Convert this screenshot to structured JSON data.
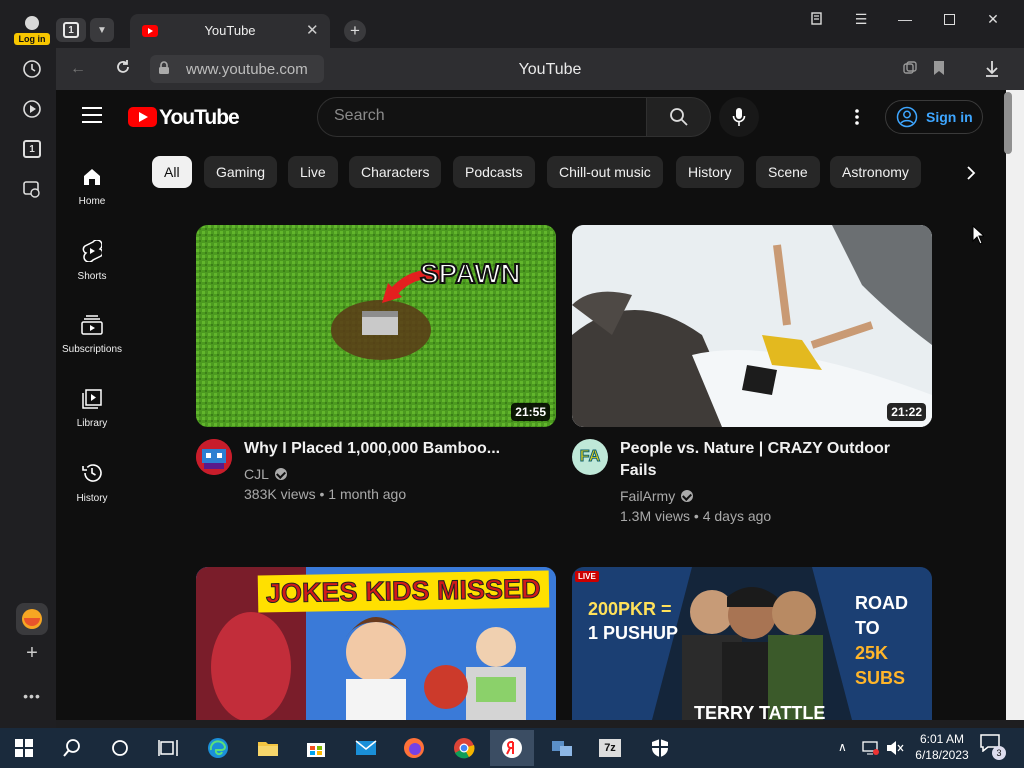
{
  "browser": {
    "login_label": "Log in",
    "tab_count": "1",
    "tab_title": "YouTube",
    "url": "www.youtube.com",
    "page_title": "YouTube",
    "sidebar_counter": "1"
  },
  "youtube": {
    "logo_text": "YouTube",
    "search_placeholder": "Search",
    "sign_in_label": "Sign in",
    "chips": [
      "All",
      "Gaming",
      "Live",
      "Characters",
      "Podcasts",
      "Chill-out music",
      "History",
      "Scene",
      "Astronomy"
    ],
    "sidebar": [
      {
        "label": "Home",
        "icon": "home-icon"
      },
      {
        "label": "Shorts",
        "icon": "shorts-icon"
      },
      {
        "label": "Subscriptions",
        "icon": "subscriptions-icon"
      },
      {
        "label": "Library",
        "icon": "library-icon"
      },
      {
        "label": "History",
        "icon": "history-icon"
      }
    ],
    "videos": [
      {
        "title": "Why I Placed 1,000,000 Bamboo...",
        "channel": "CJL",
        "meta": "383K views • 1 month ago",
        "duration": "21:55",
        "thumb_text": "SPAWN"
      },
      {
        "title_line1": "People vs. Nature | CRAZY Outdoor",
        "title_line2": "Fails",
        "channel": "FailArmy",
        "meta": "1.3M views • 4 days ago",
        "duration": "21:22",
        "avatar_text": "FA"
      },
      {
        "thumb_text": "JOKES KIDS MISSED"
      },
      {
        "live_badge": "LIVE",
        "thumb_left_line1": "200PKR =",
        "thumb_left_line2": "1 PUSHUP",
        "thumb_right_line1": "ROAD TO",
        "thumb_right_line2": "25K SUBS",
        "thumb_bottom": "TERRY TATTLE"
      }
    ]
  },
  "taskbar": {
    "time": "6:01 AM",
    "date": "6/18/2023",
    "notification_count": "3"
  },
  "colors": {
    "youtube_red": "#ff0000",
    "link_blue": "#3ea6ff",
    "page_bg": "#0f0f0f",
    "chip_bg": "#272727"
  }
}
